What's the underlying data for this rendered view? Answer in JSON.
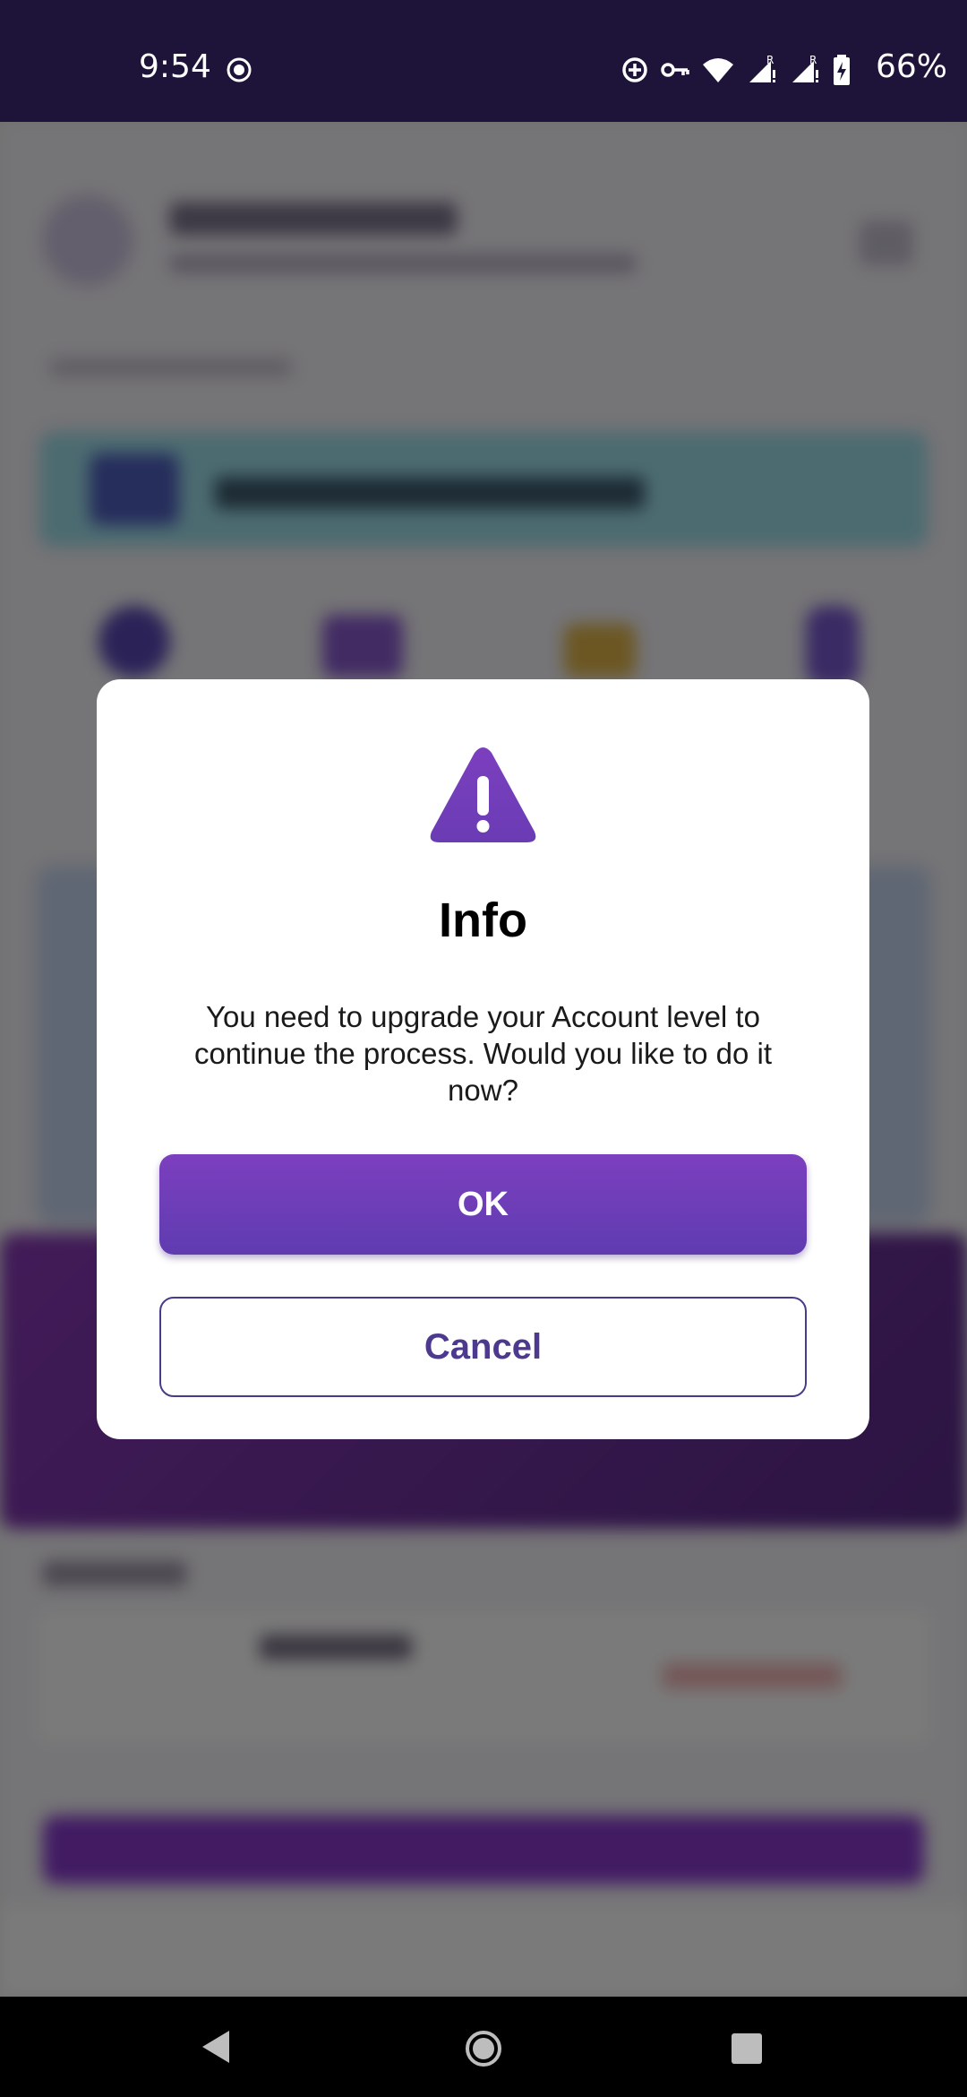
{
  "status_bar": {
    "time": "9:54",
    "battery_percent": "66%",
    "left_icons": [
      "screen-record-icon"
    ],
    "right_icons": [
      "data-saver-icon",
      "vpn-key-icon",
      "wifi-icon",
      "signal-roaming-icon",
      "signal-roaming-icon",
      "battery-charging-icon"
    ]
  },
  "dialog": {
    "icon": "warning-triangle-icon",
    "title": "Info",
    "message": "You need to upgrade your Account level to continue the process. Would you like to do it now?",
    "ok_label": "OK",
    "cancel_label": "Cancel"
  },
  "navigation_bar": {
    "buttons": [
      "back",
      "home",
      "recents"
    ]
  },
  "colors": {
    "status_bar_bg": "#1e1338",
    "accent": "#6d3dbb",
    "cancel_text": "#4d3a8f",
    "scrim": "rgba(0,0,0,0.52)"
  }
}
